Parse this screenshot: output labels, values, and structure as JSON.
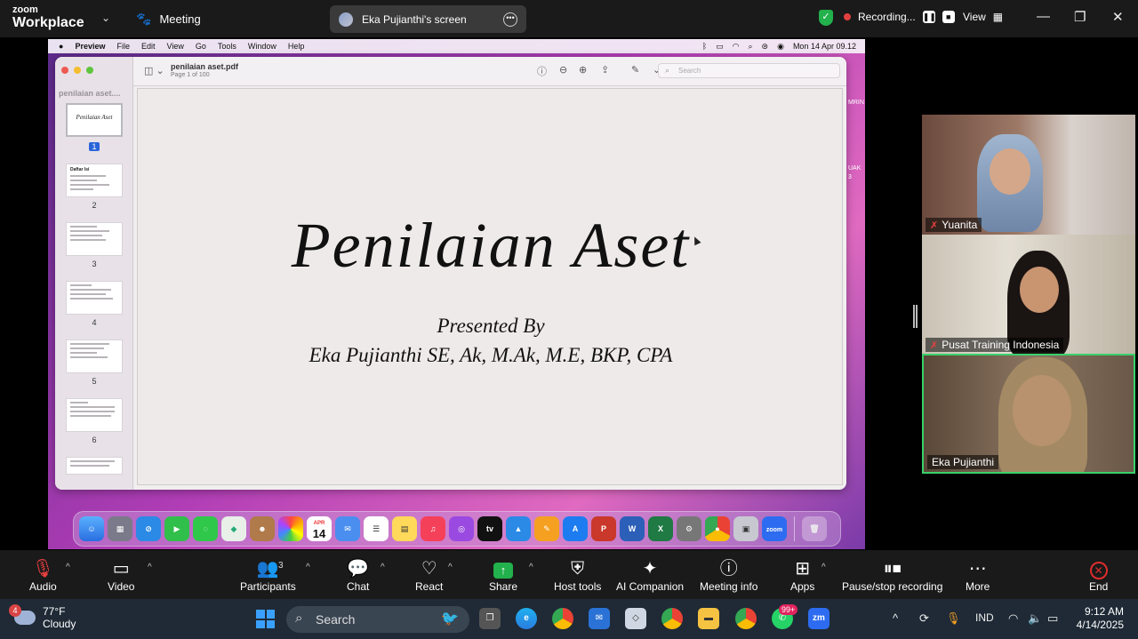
{
  "zoom": {
    "logo_top": "zoom",
    "logo_bottom": "Workplace",
    "meeting_label": "Meeting",
    "screen_share_label": "Eka Pujianthi's screen",
    "recording_label": "Recording...",
    "view_label": "View",
    "participants_count": "3"
  },
  "mac": {
    "menu": [
      "Preview",
      "File",
      "Edit",
      "View",
      "Go",
      "Tools",
      "Window",
      "Help"
    ],
    "datetime": "Mon 14 Apr  09.12",
    "dock_calendar_month": "APR",
    "dock_calendar_day": "14",
    "dock_tv_label": "tv",
    "dock_zoom_label": "zoom"
  },
  "preview": {
    "sidebar_title": "penilaian aset....",
    "file_name": "penilaian aset.pdf",
    "page_info": "Page 1 of 100",
    "search_placeholder": "Search",
    "thumb1_title": "Penilaian Aset",
    "thumb2_title": "Daftar Isi",
    "thumb_numbers": [
      "1",
      "2",
      "3",
      "4",
      "5",
      "6"
    ]
  },
  "slide": {
    "title": "Penilaian Aset",
    "presented_by": "Presented By",
    "author": "Eka Pujianthi SE, Ak, M.Ak, M.E, BKP, CPA"
  },
  "right_strip": [
    "MRIN",
    "UAK",
    "3"
  ],
  "participants": [
    {
      "name": "Yuanita",
      "muted": true
    },
    {
      "name": "Pusat Training Indonesia",
      "muted": true
    },
    {
      "name": "Eka Pujianthi",
      "muted": false
    }
  ],
  "controls": {
    "audio": "Audio",
    "video": "Video",
    "participants": "Participants",
    "chat": "Chat",
    "react": "React",
    "share": "Share",
    "host_tools": "Host tools",
    "ai_companion": "AI Companion",
    "meeting_info": "Meeting info",
    "apps": "Apps",
    "pause_stop": "Pause/stop recording",
    "more": "More",
    "end": "End"
  },
  "taskbar": {
    "weather_temp": "77°F",
    "weather_desc": "Cloudy",
    "weather_badge": "4",
    "search_label": "Search",
    "whatsapp_badge": "99+",
    "language": "IND",
    "time": "9:12 AM",
    "date": "4/14/2025",
    "zoom_label": "zm"
  },
  "colors": {
    "active_speaker": "#39d16a",
    "share_green": "#22b14c",
    "end_red": "#e02d2d"
  }
}
